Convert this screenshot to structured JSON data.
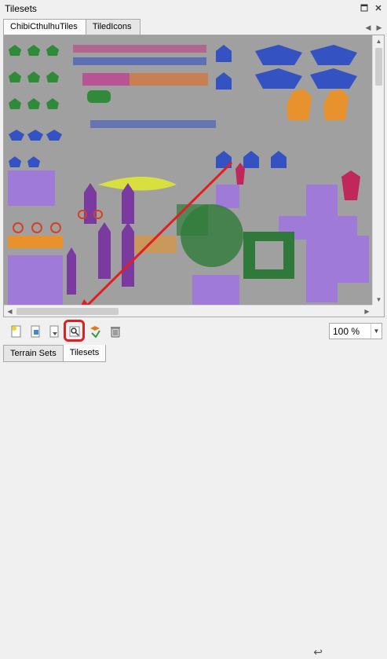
{
  "panel": {
    "title": "Tilesets",
    "float_icon": "float-icon",
    "close_icon": "close-icon"
  },
  "tabs": [
    {
      "label": "ChibiCthulhuTiles",
      "active": true
    },
    {
      "label": "TiledIcons",
      "active": false
    }
  ],
  "toolbar": {
    "icons": [
      "new-tileset-icon",
      "embed-tileset-icon",
      "export-tileset-icon",
      "edit-tileset-icon",
      "add-tiles-icon",
      "remove-tiles-icon"
    ],
    "zoom_value": "100 %",
    "undo_icon": "undo-icon"
  },
  "bottom_tabs": [
    {
      "label": "Terrain Sets",
      "active": false
    },
    {
      "label": "Tilesets",
      "active": true
    }
  ],
  "colors": {
    "canvas_bg": "#a0a0a0",
    "highlight": "#e02020",
    "purple": "#a07ad8",
    "orange": "#e08a30",
    "green": "#2f7a3a",
    "blue": "#3050c0"
  }
}
